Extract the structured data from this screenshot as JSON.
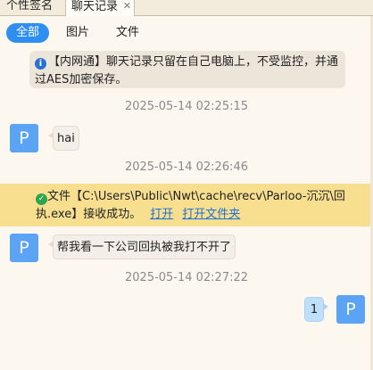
{
  "tabs": [
    {
      "label": "个性签名",
      "active": false
    },
    {
      "label": "聊天记录",
      "active": true
    }
  ],
  "filters": {
    "all": "全部",
    "images": "图片",
    "files": "文件"
  },
  "notice": {
    "text_line1": "【内网通】聊天记录只留在自己电脑上，不受监控，并通",
    "text_line2": "过AES加密保存。"
  },
  "messages": [
    {
      "time": "2025-05-14 02:25:15",
      "avatar": "P",
      "text": "hai",
      "side": "left"
    },
    {
      "time": "2025-05-14 02:26:46"
    },
    {
      "time": "",
      "avatar": "P",
      "text": "帮我看一下公司回执被我打不开了",
      "side": "left"
    },
    {
      "time": "2025-05-14 02:27:22",
      "avatar": "P",
      "text": "1",
      "side": "right"
    }
  ],
  "file_notice": {
    "line1": "文件【C:\\Users\\Public\\Nwt\\cache\\recv\\Parloo-沉沉\\回",
    "line2": "执.exe】接收成功。",
    "open_label": "打开",
    "open_folder_label": "打开文件夹"
  },
  "colors": {
    "accent": "#2f8ef2",
    "avatar": "#5aa3f5",
    "file_bar": "#f7df8f",
    "background": "#fdf8ef"
  }
}
